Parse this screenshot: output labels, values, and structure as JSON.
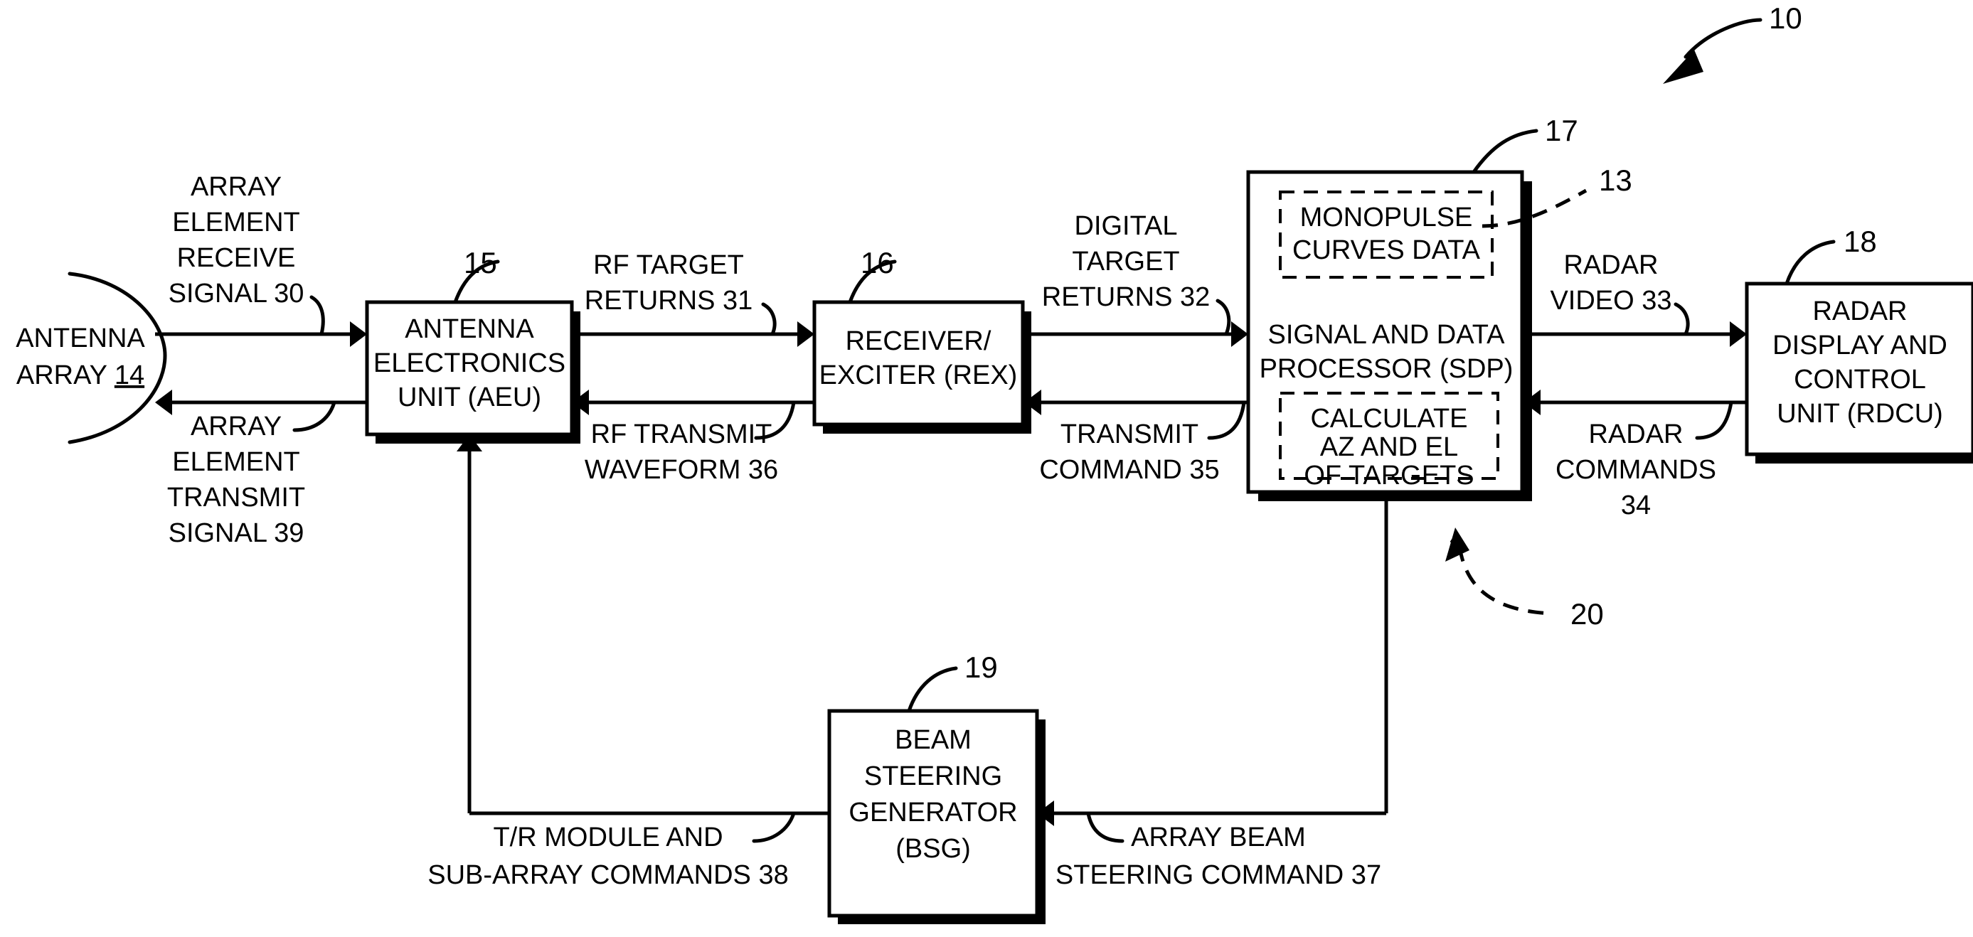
{
  "figure": {
    "reference_numeral": "10",
    "type": "radar-system-block-diagram"
  },
  "blocks": [
    {
      "id": "antenna-array",
      "ref": "14",
      "lines": [
        "ANTENNA",
        "ARRAY 14"
      ],
      "line1": "ANTENNA",
      "line2_prefix": "ARRAY ",
      "line2_ref": "14",
      "shape": "arc"
    },
    {
      "id": "aeu",
      "ref": "15",
      "line1": "ANTENNA",
      "line2": "ELECTRONICS",
      "line3": "UNIT (AEU)",
      "shape": "rect-shadow"
    },
    {
      "id": "rex",
      "ref": "16",
      "line1": "RECEIVER/",
      "line2": "EXCITER (REX)",
      "shape": "rect-shadow"
    },
    {
      "id": "sdp",
      "ref": "17",
      "line1": "SIGNAL AND DATA",
      "line2": "PROCESSOR (SDP)",
      "shape": "rect-shadow"
    },
    {
      "id": "monopulse-curves-data",
      "ref": "13",
      "line1": "MONOPULSE",
      "line2": "CURVES DATA",
      "shape": "dashed-rect"
    },
    {
      "id": "calculate-az-el",
      "ref": "20",
      "line1": "CALCULATE",
      "line2": "AZ AND EL",
      "line3": "OF TARGETS",
      "shape": "dashed-rect"
    },
    {
      "id": "rdcu",
      "ref": "18",
      "line1": "RADAR",
      "line2": "DISPLAY AND",
      "line3": "CONTROL",
      "line4": "UNIT (RDCU)",
      "shape": "rect-shadow"
    },
    {
      "id": "bsg",
      "ref": "19",
      "line1": "BEAM",
      "line2": "STEERING",
      "line3": "GENERATOR",
      "line4": "(BSG)",
      "shape": "rect-shadow"
    }
  ],
  "signals": [
    {
      "id": "array-element-receive-signal",
      "ref": "30",
      "line1": "ARRAY",
      "line2": "ELEMENT",
      "line3": "RECEIVE",
      "line4": "SIGNAL 30"
    },
    {
      "id": "array-element-transmit-signal",
      "ref": "39",
      "line1": "ARRAY",
      "line2": "ELEMENT",
      "line3": "TRANSMIT",
      "line4": "SIGNAL 39"
    },
    {
      "id": "rf-target-returns",
      "ref": "31",
      "line1": "RF TARGET",
      "line2": "RETURNS 31"
    },
    {
      "id": "rf-transmit-waveform",
      "ref": "36",
      "line1": "RF TRANSMIT",
      "line2": "WAVEFORM 36"
    },
    {
      "id": "digital-target-returns",
      "ref": "32",
      "line1": "DIGITAL",
      "line2": "TARGET",
      "line3": "RETURNS 32"
    },
    {
      "id": "transmit-command",
      "ref": "35",
      "line1": "TRANSMIT",
      "line2": "COMMAND 35"
    },
    {
      "id": "radar-video",
      "ref": "33",
      "line1": "RADAR",
      "line2": "VIDEO 33"
    },
    {
      "id": "radar-commands",
      "ref": "34",
      "line1": "RADAR",
      "line2": "COMMANDS",
      "line3": "34"
    },
    {
      "id": "tr-module-subarray-commands",
      "ref": "38",
      "line1": "T/R MODULE AND",
      "line2": "SUB-ARRAY COMMANDS 38"
    },
    {
      "id": "array-beam-steering-command",
      "ref": "37",
      "line1": "ARRAY BEAM",
      "line2": "STEERING COMMAND 37"
    }
  ],
  "colors": {
    "ink": "#000000",
    "paper": "#ffffff"
  }
}
